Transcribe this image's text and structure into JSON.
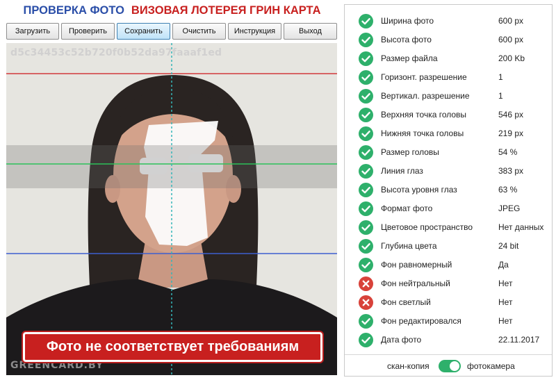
{
  "title": {
    "part1": "ПРОВЕРКА ФОТО",
    "part2": "ВИЗОВАЯ ЛОТЕРЕЯ ГРИН КАРТА"
  },
  "toolbar": {
    "buttons": [
      {
        "label": "Загрузить"
      },
      {
        "label": "Проверить"
      },
      {
        "label": "Сохранить"
      },
      {
        "label": "Очистить"
      },
      {
        "label": "Инструкция"
      },
      {
        "label": "Выход"
      }
    ]
  },
  "photo": {
    "hash": "d5c34453c52b720f0b52da97faaaf1ed",
    "watermark": "GREENCARD.BY",
    "verdict": "Фото не соответствует требованиям"
  },
  "checks": [
    {
      "label": "Ширина фото",
      "value": "600 px",
      "status": "ok"
    },
    {
      "label": "Высота фото",
      "value": "600 px",
      "status": "ok"
    },
    {
      "label": "Размер файла",
      "value": "200 Kb",
      "status": "ok"
    },
    {
      "label": "Горизонт. разрешение",
      "value": "1",
      "status": "ok"
    },
    {
      "label": "Вертикал. разрешение",
      "value": "1",
      "status": "ok"
    },
    {
      "label": "Верхняя точка головы",
      "value": "546 px",
      "status": "ok"
    },
    {
      "label": "Нижняя точка головы",
      "value": "219 px",
      "status": "ok"
    },
    {
      "label": "Размер головы",
      "value": "54 %",
      "status": "ok"
    },
    {
      "label": "Линия глаз",
      "value": "383 px",
      "status": "ok"
    },
    {
      "label": "Высота уровня глаз",
      "value": "63 %",
      "status": "ok"
    },
    {
      "label": "Формат фото",
      "value": "JPEG",
      "status": "ok"
    },
    {
      "label": "Цветовое пространство",
      "value": "Нет данных",
      "status": "ok"
    },
    {
      "label": "Глубина цвета",
      "value": "24 bit",
      "status": "ok"
    },
    {
      "label": "Фон равномерный",
      "value": "Да",
      "status": "ok"
    },
    {
      "label": "Фон нейтральный",
      "value": "Нет",
      "status": "fail"
    },
    {
      "label": "Фон светлый",
      "value": "Нет",
      "status": "fail"
    },
    {
      "label": "Фон редактировался",
      "value": "Нет",
      "status": "ok"
    },
    {
      "label": "Дата фото",
      "value": "22.11.2017",
      "status": "ok"
    }
  ],
  "mode": {
    "left_label": "скан-копия",
    "right_label": "фотокамера",
    "state": "фотокамера"
  },
  "colors": {
    "ok": "#2eb06b",
    "fail": "#d8423a",
    "title_blue": "#2a4ea8",
    "title_red": "#c8201f"
  }
}
